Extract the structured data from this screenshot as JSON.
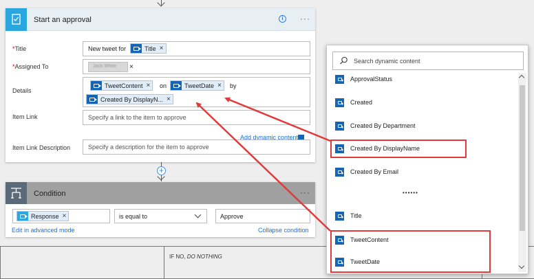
{
  "approval": {
    "title": "Start an approval",
    "fields": {
      "title_label": "Title",
      "title_static": "New tweet for",
      "title_token": "Title",
      "assigned_label": "Assigned To",
      "assigned_value": "Jack White",
      "details_label": "Details",
      "details_token1": "TweetContent",
      "details_on": "on",
      "details_token2": "TweetDate",
      "details_by": "by",
      "details_token3": "Created By DisplayN...",
      "item_link_label": "Item Link",
      "item_link_placeholder": "Specify a link to the item to approve",
      "item_link_desc_label": "Item Link Description",
      "item_link_desc_placeholder": "Specify a description for the item to approve"
    },
    "add_dynamic": "Add dynamic content",
    "required_mark": "*",
    "more": "···",
    "info": "i"
  },
  "connector_plus": "+",
  "condition": {
    "title": "Condition",
    "token": "Response",
    "operator": "is equal to",
    "value": "Approve",
    "edit_advanced": "Edit in advanced mode",
    "collapse": "Collapse condition",
    "more": "···"
  },
  "branch": {
    "no_prefix": "IF NO, ",
    "no_text": "DO NOTHING"
  },
  "dynamic_panel": {
    "search_placeholder": "Search dynamic content",
    "items": [
      "ApprovalStatus",
      "Created",
      "Created By Department",
      "Created By DisplayName",
      "Created By Email",
      "••••••",
      "Title",
      "TweetContent",
      "TweetDate"
    ]
  },
  "token_remove": "×",
  "colors": {
    "accent": "#2aa7df",
    "token_icon": "#1565b6",
    "link": "#1a6fd1",
    "annotation": "#e13a3a"
  }
}
